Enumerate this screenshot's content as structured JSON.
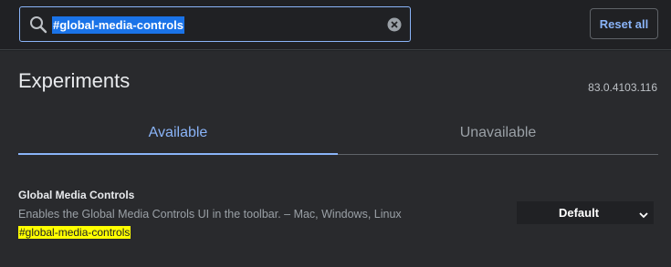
{
  "search": {
    "value": "#global-media-controls",
    "icon": "search-icon",
    "clear_icon": "clear-icon"
  },
  "toolbar": {
    "reset_label": "Reset all"
  },
  "page": {
    "title": "Experiments",
    "version": "83.0.4103.116"
  },
  "tabs": [
    {
      "label": "Available",
      "active": true
    },
    {
      "label": "Unavailable",
      "active": false
    }
  ],
  "experiment": {
    "name": "Global Media Controls",
    "description": "Enables the Global Media Controls UI in the toolbar. – Mac, Windows, Linux",
    "link": "#global-media-controls",
    "selected_option": "Default"
  },
  "colors": {
    "accent": "#8ab4f8",
    "highlight": "#ffff00",
    "selection": "#1a73e8",
    "background": "#202124",
    "panel": "#292a2d"
  }
}
